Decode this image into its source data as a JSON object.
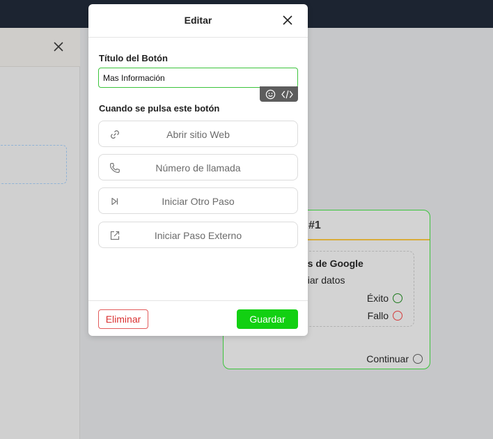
{
  "modal": {
    "title": "Editar",
    "title_label": "Título del Botón",
    "title_value": "Mas Información",
    "actions_label": "Cuando se pulsa este botón",
    "actions": [
      {
        "label": "Abrir sitio Web",
        "icon": "link-icon"
      },
      {
        "label": "Número de llamada",
        "icon": "phone-icon"
      },
      {
        "label": "Iniciar Otro Paso",
        "icon": "skip-next-icon"
      },
      {
        "label": "Iniciar Paso Externo",
        "icon": "external-link-icon"
      }
    ],
    "toolbar": {
      "emoji_icon": "emoji-icon",
      "code_icon": "code-icon"
    },
    "delete_label": "Eliminar",
    "save_label": "Guardar"
  },
  "flow_node": {
    "header": "#1",
    "block_title": "jas de Google",
    "block_subtitle": "nviar datos",
    "success_label": "Éxito",
    "fail_label": "Fallo",
    "continue_label": "Continuar"
  },
  "side_panel": {
    "close_icon": "close-icon"
  },
  "colors": {
    "accent_green": "#12d012",
    "danger_red": "#d93030",
    "node_border": "#3cc43c",
    "node_header_line": "#d9ac3a",
    "topbar": "#1c2431"
  }
}
